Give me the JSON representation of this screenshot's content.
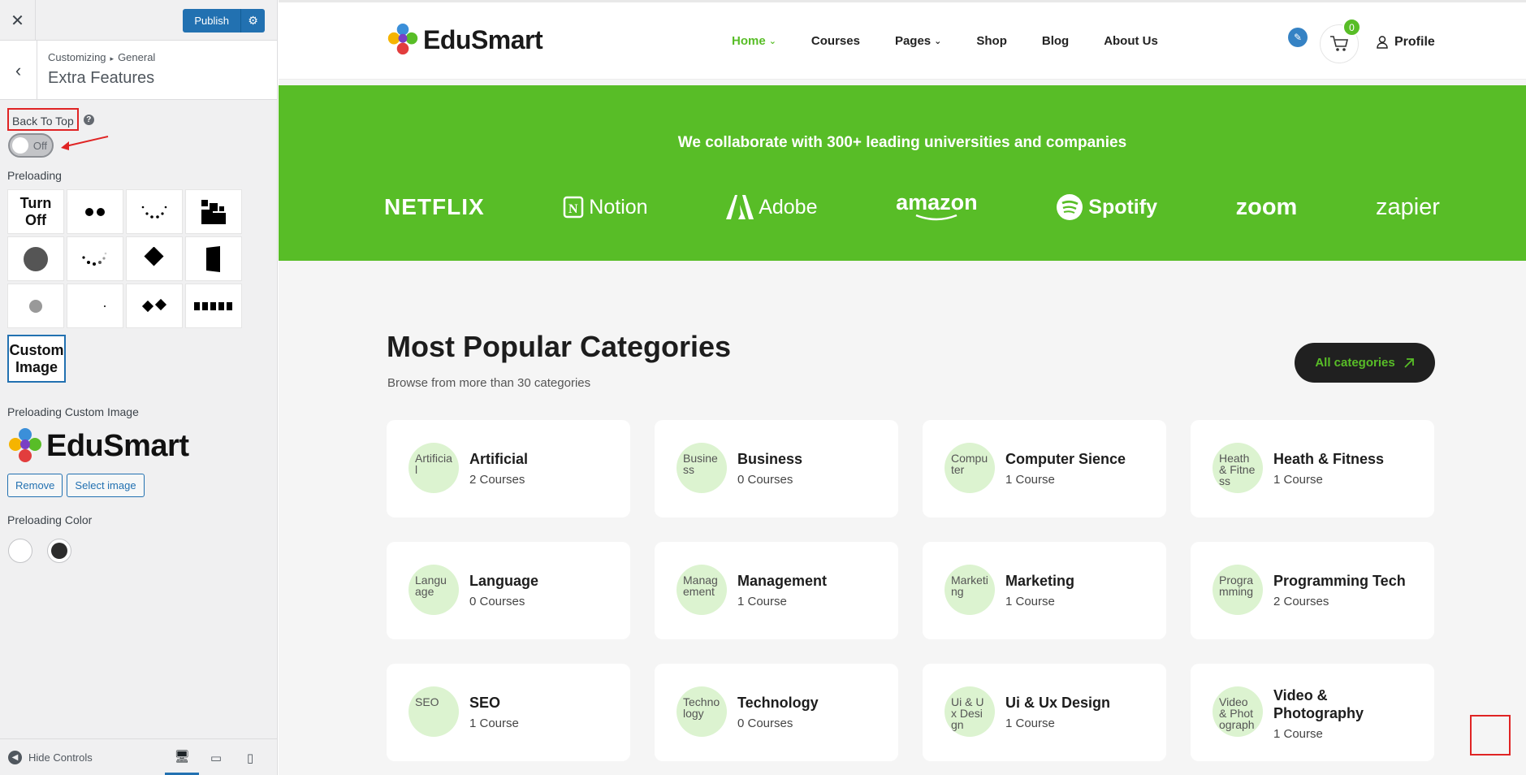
{
  "sidebar": {
    "close_icon": "close-icon",
    "publish_label": "Publish",
    "breadcrumb": [
      "Customizing",
      "General"
    ],
    "section_title": "Extra Features",
    "back_to_top": {
      "label": "Back To Top",
      "help": "?",
      "toggle_text": "Off"
    },
    "preloading": {
      "label": "Preloading",
      "options": [
        "Turn Off",
        "dots-2",
        "dots-arc",
        "blocks",
        "circle",
        "dots-spinner",
        "diamond",
        "rect",
        "small-circle",
        "point",
        "double-diamond",
        "bars"
      ],
      "turn_off_label": "Turn Off",
      "custom_image_label": "Custom Image"
    },
    "preloading_custom_image": {
      "label": "Preloading Custom Image",
      "logo_text": "EduSmart",
      "remove_label": "Remove",
      "select_label": "Select image"
    },
    "preloading_color": {
      "label": "Preloading Color",
      "colors": [
        "#ffffff",
        "#2c2c2c"
      ]
    },
    "footer": {
      "hide_controls": "Hide Controls"
    }
  },
  "site": {
    "logo_text": "EduSmart",
    "nav": [
      {
        "label": "Home",
        "dropdown": true,
        "active": true
      },
      {
        "label": "Courses",
        "dropdown": false
      },
      {
        "label": "Pages",
        "dropdown": true
      },
      {
        "label": "Shop",
        "dropdown": false
      },
      {
        "label": "Blog",
        "dropdown": false
      },
      {
        "label": "About Us",
        "dropdown": false
      }
    ],
    "cart_count": "0",
    "profile_label": "Profile",
    "accent_color": "#58bd27",
    "partners_title": "We collaborate with 300+ leading universities and companies",
    "brands": [
      "NETFLIX",
      "Notion",
      "Adobe",
      "amazon",
      "Spotify",
      "zoom",
      "zapier"
    ],
    "categories_title": "Most Popular Categories",
    "categories_subtitle": "Browse from more than 30 categories",
    "all_categories_label": "All categories",
    "categories": [
      {
        "name": "Artificial",
        "count": "2 Courses",
        "alt": "Artificial"
      },
      {
        "name": "Business",
        "count": "0 Courses",
        "alt": "Business"
      },
      {
        "name": "Computer Sience",
        "count": "1 Course",
        "alt": "Computer"
      },
      {
        "name": "Heath & Fitness",
        "count": "1 Course",
        "alt": "Heath & Fitness"
      },
      {
        "name": "Language",
        "count": "0 Courses",
        "alt": "Language"
      },
      {
        "name": "Management",
        "count": "1 Course",
        "alt": "Management"
      },
      {
        "name": "Marketing",
        "count": "1 Course",
        "alt": "Marketing"
      },
      {
        "name": "Programming Tech",
        "count": "2 Courses",
        "alt": "Programming"
      },
      {
        "name": "SEO",
        "count": "1 Course",
        "alt": "SEO"
      },
      {
        "name": "Technology",
        "count": "0 Courses",
        "alt": "Technology"
      },
      {
        "name": "Ui & Ux Design",
        "count": "1 Course",
        "alt": "Ui & Ux Design"
      },
      {
        "name": "Video & Photography",
        "count": "1 Course",
        "alt": "Video & Photography"
      }
    ]
  }
}
